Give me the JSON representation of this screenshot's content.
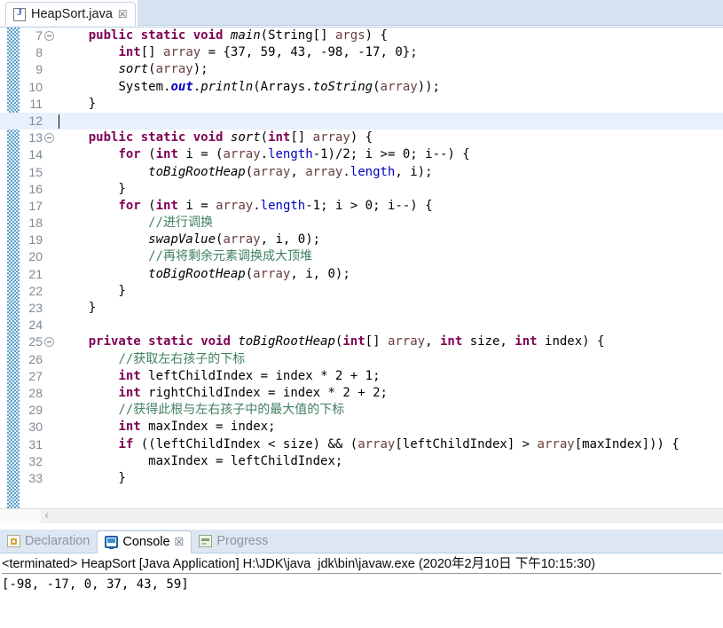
{
  "editor": {
    "tab": {
      "label": "HeapSort.java",
      "icon": "java-file-icon",
      "close": "☒"
    },
    "current_line": 12,
    "lines": [
      {
        "num": "7",
        "fold": true,
        "indent": 0
      },
      {
        "num": "8",
        "fold": false,
        "indent": 0
      },
      {
        "num": "9",
        "fold": false,
        "indent": 0
      },
      {
        "num": "10",
        "fold": false,
        "indent": 0
      },
      {
        "num": "11",
        "fold": false,
        "indent": 0
      },
      {
        "num": "12",
        "fold": false,
        "indent": 0
      },
      {
        "num": "13",
        "fold": true,
        "indent": 0
      },
      {
        "num": "14",
        "fold": false,
        "indent": 0
      },
      {
        "num": "15",
        "fold": false,
        "indent": 0
      },
      {
        "num": "16",
        "fold": false,
        "indent": 0
      },
      {
        "num": "17",
        "fold": false,
        "indent": 0
      },
      {
        "num": "18",
        "fold": false,
        "indent": 0
      },
      {
        "num": "19",
        "fold": false,
        "indent": 0
      },
      {
        "num": "20",
        "fold": false,
        "indent": 0
      },
      {
        "num": "21",
        "fold": false,
        "indent": 0
      },
      {
        "num": "22",
        "fold": false,
        "indent": 0
      },
      {
        "num": "23",
        "fold": false,
        "indent": 0
      },
      {
        "num": "24",
        "fold": false,
        "indent": 0
      },
      {
        "num": "25",
        "fold": true,
        "indent": 0
      },
      {
        "num": "26",
        "fold": false,
        "indent": 0
      },
      {
        "num": "27",
        "fold": false,
        "indent": 0
      },
      {
        "num": "28",
        "fold": false,
        "indent": 0
      },
      {
        "num": "29",
        "fold": false,
        "indent": 0
      },
      {
        "num": "30",
        "fold": false,
        "indent": 0
      },
      {
        "num": "31",
        "fold": false,
        "indent": 0
      },
      {
        "num": "32",
        "fold": false,
        "indent": 0
      },
      {
        "num": "33",
        "fold": false,
        "indent": 0
      }
    ],
    "code": [
      "    public static void main(String[] args) {",
      "        int[] array = {37, 59, 43, -98, -17, 0};",
      "        sort(array);",
      "        System.out.println(Arrays.toString(array));",
      "    }",
      "",
      "    public static void sort(int[] array) {",
      "        for (int i = (array.length-1)/2; i >= 0; i--) {",
      "            toBigRootHeap(array, array.length, i);",
      "        }",
      "        for (int i = array.length-1; i > 0; i--) {",
      "            //进行调换",
      "            swapValue(array, i, 0);",
      "            //再将剩余元素调换成大顶堆",
      "            toBigRootHeap(array, i, 0);",
      "        }",
      "    }",
      "",
      "    private static void toBigRootHeap(int[] array, int size, int index) {",
      "        //获取左右孩子的下标",
      "        int leftChildIndex = index * 2 + 1;",
      "        int rightChildIndex = index * 2 + 2;",
      "        //获得此根与左右孩子中的最大值的下标",
      "        int maxIndex = index;",
      "        if ((leftChildIndex < size) && (array[leftChildIndex] > array[maxIndex])) {",
      "            maxIndex = leftChildIndex;",
      "        }"
    ],
    "scrollbar": {
      "left_arrow": "‹"
    }
  },
  "console": {
    "tabs": [
      {
        "label": "Declaration",
        "icon": "declaration-icon",
        "active": false,
        "closable": false
      },
      {
        "label": "Console",
        "icon": "console-icon",
        "active": true,
        "closable": true,
        "close": "☒"
      },
      {
        "label": "Progress",
        "icon": "progress-icon",
        "active": false,
        "closable": false
      }
    ],
    "header": "<terminated> HeapSort [Java Application] H:\\JDK\\java  jdk\\bin\\javaw.exe (2020年2月10日 下午10:15:30)",
    "output": "[-98, -17, 0, 37, 43, 59]"
  },
  "colors": {
    "keyword": "#7f0055",
    "comment": "#3f7f5f",
    "field": "#0000c0",
    "parameter": "#6a3e3e",
    "tab_bar": "#d6e2f0",
    "current_line": "#e8f0fc",
    "change_bar": "#5da2d0"
  }
}
